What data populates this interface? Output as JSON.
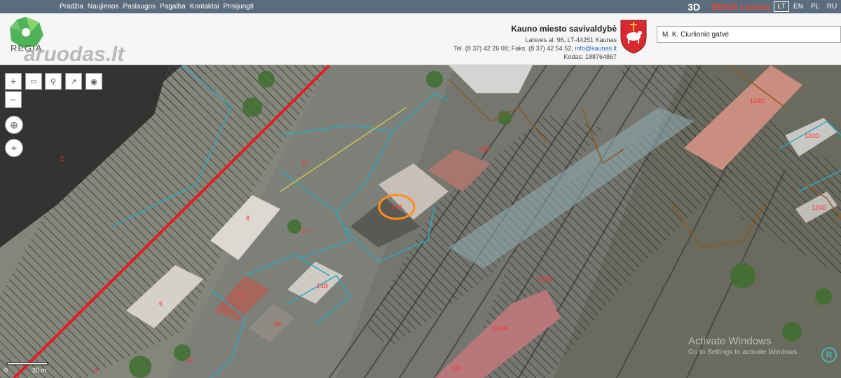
{
  "nav": {
    "items": [
      "Pradžia",
      "Naujienos",
      "Paslaugos",
      "Pagalba",
      "Kontaktai",
      "Prisijungti"
    ]
  },
  "toolbar_right": {
    "btn_3d": "3D",
    "brand": "REGIA Lietuva",
    "languages": [
      "LT",
      "EN",
      "PL",
      "RU"
    ],
    "active_language": "LT"
  },
  "header": {
    "logo_text": "REGIA",
    "watermark": "aruodas.lt",
    "org_name": "Kauno miesto savivaldybė",
    "address": "Laisvės al. 96, LT-44251 Kaunas",
    "phone": "Tel. (8 37) 42 26 08; Faks. (8 37) 42 54 52,",
    "email": "info@kaunas.lt",
    "code": "Kodas: 188764867",
    "search_value": "M. K. Čiurlionio gatvė"
  },
  "map": {
    "parcel_labels": [
      "2",
      "10",
      "8",
      "14",
      "14A",
      "14B",
      "12",
      "6",
      "8A",
      "6C",
      "4",
      "124C",
      "124D",
      "124E",
      "124B",
      "124A",
      "124",
      "14P"
    ],
    "scale": [
      "0",
      "20 m"
    ],
    "tools": [
      "zoom-in",
      "zoom-out",
      "measure",
      "pin",
      "export",
      "target",
      "compass",
      "locate"
    ]
  },
  "system": {
    "activate_title": "Activate Windows",
    "activate_sub": "Go to Settings to activate Windows."
  },
  "colors": {
    "nav_bg": "#5b6c7d",
    "brand_red": "#e2473e",
    "parcel_red": "#ff3030",
    "highlight_ring": "#ff8c1a",
    "road_red": "#e02020"
  }
}
